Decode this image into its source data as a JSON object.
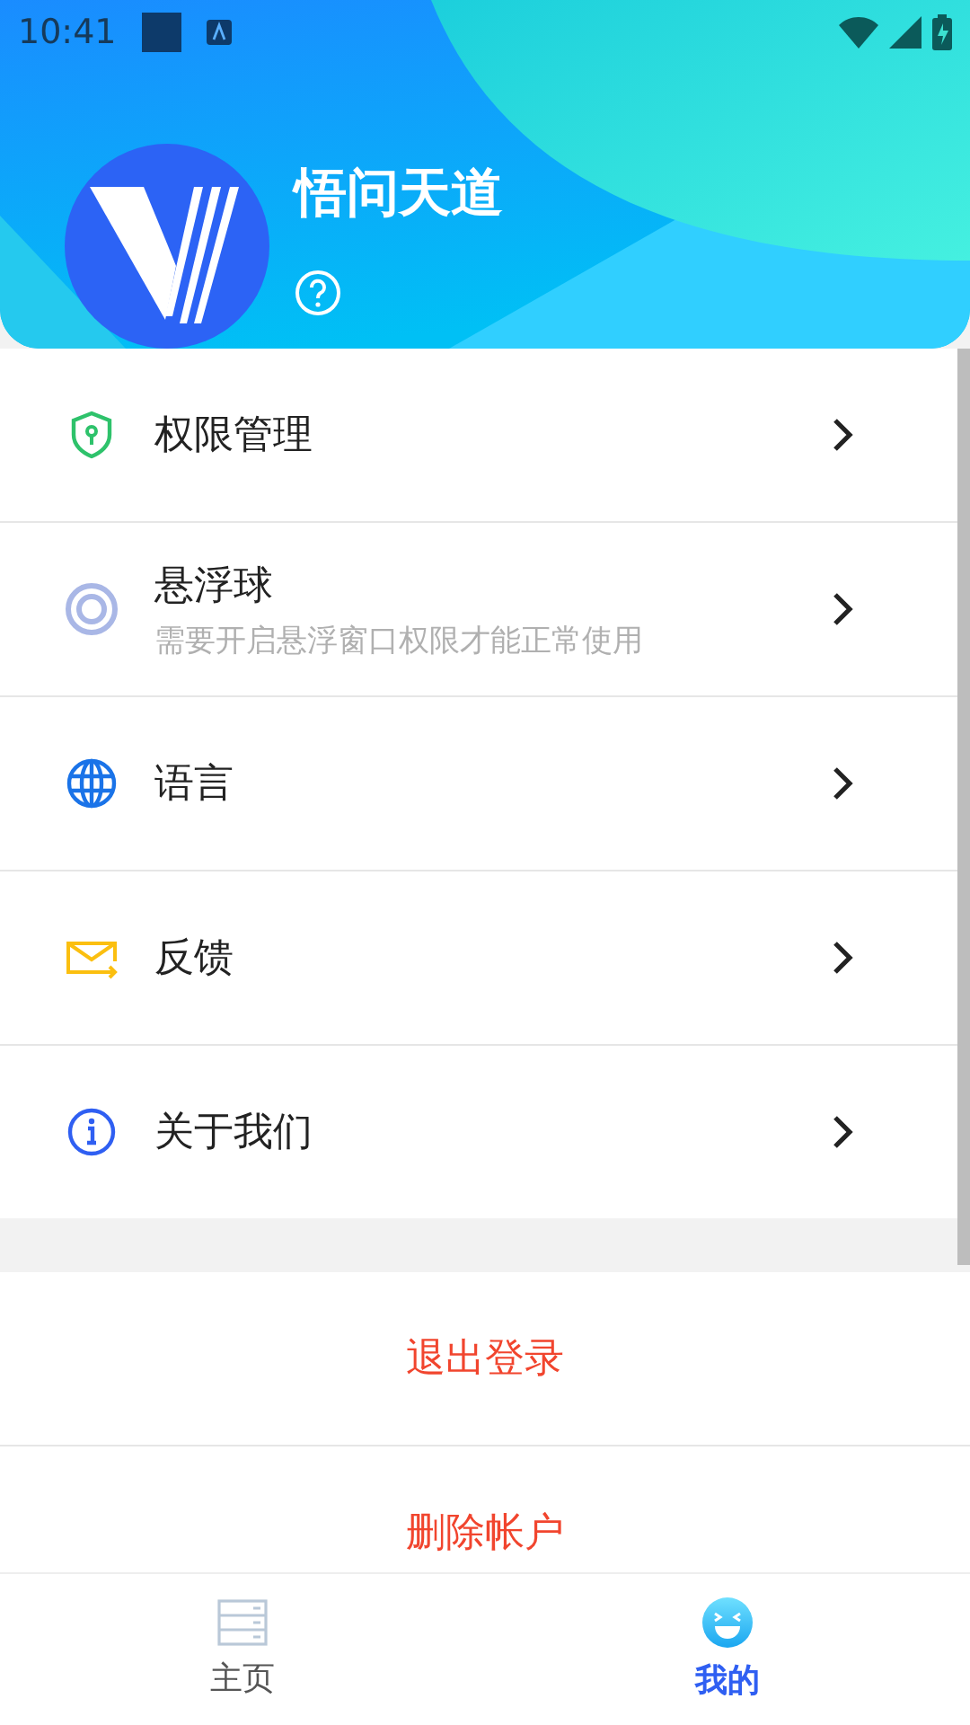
{
  "status_bar": {
    "time": "10:41"
  },
  "profile": {
    "name": "悟问天道"
  },
  "menu": [
    {
      "kind": "shield",
      "title": "权限管理"
    },
    {
      "kind": "ring",
      "title": "悬浮球",
      "subtitle": "需要开启悬浮窗口权限才能正常使用"
    },
    {
      "kind": "globe",
      "title": "语言"
    },
    {
      "kind": "mail",
      "title": "反馈"
    },
    {
      "kind": "info",
      "title": "关于我们"
    }
  ],
  "actions": [
    "退出登录",
    "删除帐户"
  ],
  "tabs": [
    {
      "kind": "home",
      "label": "主页",
      "selected": false
    },
    {
      "kind": "me",
      "label": "我的",
      "selected": true
    }
  ]
}
